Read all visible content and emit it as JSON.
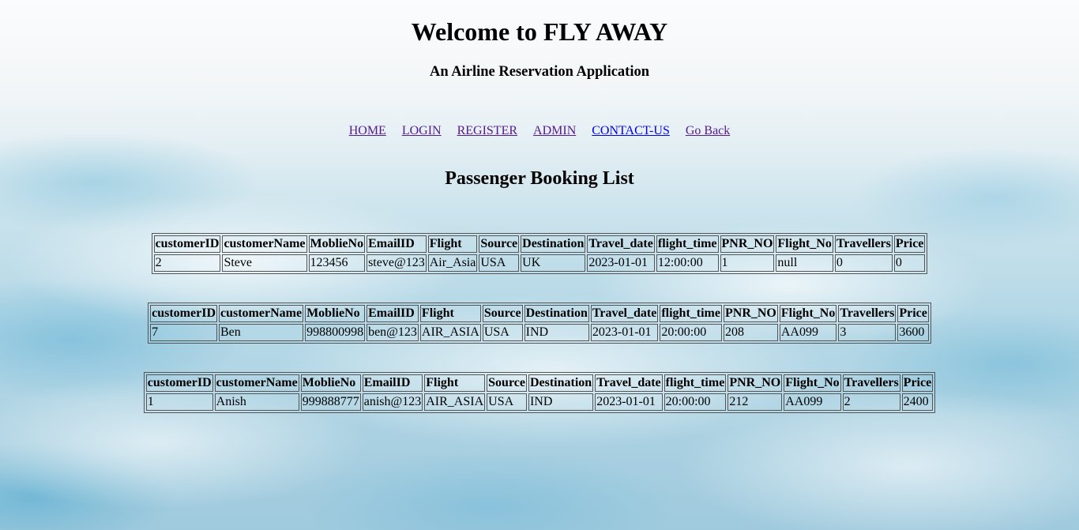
{
  "header": {
    "title": "Welcome to FLY AWAY",
    "subtitle": "An Airline Reservation Application"
  },
  "nav": {
    "items": [
      {
        "label": "HOME"
      },
      {
        "label": "LOGIN"
      },
      {
        "label": "REGISTER"
      },
      {
        "label": "ADMIN"
      },
      {
        "label": "CONTACT-US"
      },
      {
        "label": "Go Back"
      }
    ]
  },
  "page_title": "Passenger Booking List",
  "columns": [
    "customerID",
    "customerName",
    "MoblieNo",
    "EmailID",
    "Flight",
    "Source",
    "Destination",
    "Travel_date",
    "flight_time",
    "PNR_NO",
    "Flight_No",
    "Travellers",
    "Price"
  ],
  "bookings": [
    [
      "2",
      "Steve",
      "123456",
      "steve@123",
      "Air_Asia",
      "USA",
      "UK",
      "2023-01-01",
      "12:00:00",
      "1",
      "null",
      "0",
      "0"
    ],
    [
      "7",
      "Ben",
      "998800998",
      "ben@123",
      "AIR_ASIA",
      "USA",
      "IND",
      "2023-01-01",
      "20:00:00",
      "208",
      "AA099",
      "3",
      "3600"
    ],
    [
      "1",
      "Anish",
      "999888777",
      "anish@123",
      "AIR_ASIA",
      "USA",
      "IND",
      "2023-01-01",
      "20:00:00",
      "212",
      "AA099",
      "2",
      "2400"
    ]
  ]
}
